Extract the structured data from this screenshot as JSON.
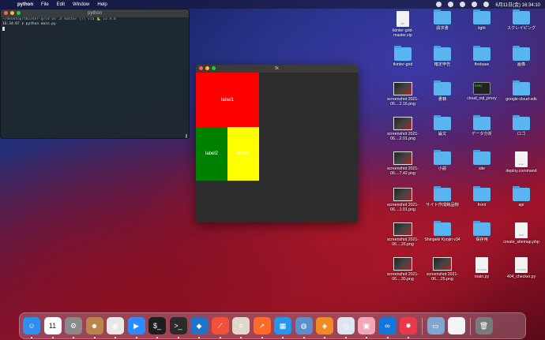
{
  "menubar": {
    "app_name": "python",
    "menus": [
      "File",
      "Edit",
      "Window",
      "Help"
    ],
    "clock": "6月11日(金)  16:34:10"
  },
  "terminal": {
    "title": "python",
    "prompt_line": "~/desktop/tkinter-grid on ⎇ master [?] via 🐍 v3.9.0",
    "cmd_line": "16:34:07 ❯ python main.py"
  },
  "tk": {
    "title": "tk",
    "label1": "label1",
    "label2": "label2",
    "label3": "label3"
  },
  "desktop": [
    {
      "kind": "doc",
      "label": "tkinter-grid-master.zip",
      "doctext": "ZIP"
    },
    {
      "kind": "folder",
      "label": "請求書"
    },
    {
      "kind": "folder",
      "label": "light"
    },
    {
      "kind": "folder",
      "label": "スクレイピング"
    },
    {
      "kind": "folder",
      "label": "tkinter-grid"
    },
    {
      "kind": "folder",
      "label": "確定申告"
    },
    {
      "kind": "folder",
      "label": "firebase"
    },
    {
      "kind": "folder",
      "label": "画像"
    },
    {
      "kind": "thumb",
      "label": "screenshot 2021-06....2.16.png"
    },
    {
      "kind": "folder",
      "label": "書籍"
    },
    {
      "kind": "term",
      "label": "cloud_sql_proxy"
    },
    {
      "kind": "folder",
      "label": "google-cloud-sdk"
    },
    {
      "kind": "thumb",
      "label": "screenshot 2021-06....2.01.png"
    },
    {
      "kind": "folder",
      "label": "論文"
    },
    {
      "kind": "folder",
      "label": "データ分析"
    },
    {
      "kind": "folder",
      "label": "ロゴ"
    },
    {
      "kind": "thumb",
      "label": "screenshot 2021-06....7.42.png"
    },
    {
      "kind": "folder",
      "label": "小説"
    },
    {
      "kind": "folder",
      "label": "site"
    },
    {
      "kind": "doc",
      "label": "deploy.command",
      "doctext": "exec"
    },
    {
      "kind": "thumb",
      "label": "screenshot 2021-06....1.01.png"
    },
    {
      "kind": "folder",
      "label": "サイト作成納品物"
    },
    {
      "kind": "folder",
      "label": "front"
    },
    {
      "kind": "folder",
      "label": "api"
    },
    {
      "kind": "thumb",
      "label": "screenshot 2021-06....26.png"
    },
    {
      "kind": "folder",
      "label": "Shingeki Kyojin v34"
    },
    {
      "kind": "folder",
      "label": "保存用"
    },
    {
      "kind": "doc",
      "label": "create_sitemap.php",
      "doctext": "PHP"
    },
    {
      "kind": "thumb",
      "label": "screenshot 2021-06....30.png"
    },
    {
      "kind": "thumb",
      "label": "screenshot 2021-06....25.png"
    },
    {
      "kind": "doc",
      "label": "main.py",
      "doctext": "PYTHON"
    },
    {
      "kind": "doc",
      "label": "404_checker.py",
      "doctext": "PYTHON"
    }
  ],
  "dock": {
    "calendar_day": "11",
    "apps": [
      {
        "name": "finder",
        "color": "#2f8ef0",
        "glyph": "☺"
      },
      {
        "name": "calendar",
        "color": "#ffffff",
        "glyph": ""
      },
      {
        "name": "system-preferences",
        "color": "#8a8a8a",
        "glyph": "⚙"
      },
      {
        "name": "contacts",
        "color": "#b8864a",
        "glyph": "☻"
      },
      {
        "name": "chrome",
        "color": "#e8e8e8",
        "glyph": "◉"
      },
      {
        "name": "zoom",
        "color": "#2d8cff",
        "glyph": "▶"
      },
      {
        "name": "iterm",
        "color": "#1e1e1e",
        "glyph": "$_"
      },
      {
        "name": "terminal",
        "color": "#2b2b2b",
        "glyph": ">_"
      },
      {
        "name": "vscode",
        "color": "#1e74c8",
        "glyph": "◆"
      },
      {
        "name": "swift",
        "color": "#f05138",
        "glyph": "⟋"
      },
      {
        "name": "sequel",
        "color": "#e0d8c8",
        "glyph": "≡"
      },
      {
        "name": "activity",
        "color": "#ff6a2a",
        "glyph": "↗"
      },
      {
        "name": "docker",
        "color": "#2496ed",
        "glyph": "▦"
      },
      {
        "name": "wireshark",
        "color": "#5b8fc9",
        "glyph": "◍"
      },
      {
        "name": "sourcetree",
        "color": "#f08a24",
        "glyph": "◈"
      },
      {
        "name": "camera",
        "color": "#dde6f0",
        "glyph": "◎"
      },
      {
        "name": "sketch",
        "color": "#f2a6b8",
        "glyph": "▣"
      },
      {
        "name": "infinity",
        "color": "#1276e0",
        "glyph": "∞"
      },
      {
        "name": "clock",
        "color": "#e8384a",
        "glyph": "✸"
      },
      {
        "name": "preview",
        "color": "#7ea6d0",
        "glyph": "▭"
      },
      {
        "name": "document",
        "color": "#f4f4f4",
        "glyph": ""
      },
      {
        "name": "trash",
        "color": "#7a7a7a",
        "glyph": "🗑"
      }
    ]
  }
}
